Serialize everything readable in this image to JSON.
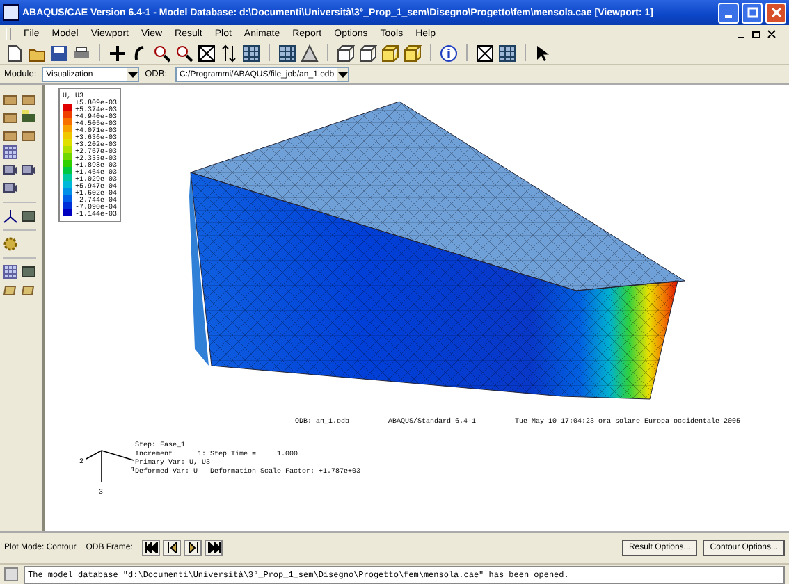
{
  "window": {
    "title": "ABAQUS/CAE Version 6.4-1 - Model Database: d:\\Documenti\\Università\\3°_Prop_1_sem\\Disegno\\Progetto\\fem\\mensola.cae [Viewport: 1]"
  },
  "menu": [
    "File",
    "Model",
    "Viewport",
    "View",
    "Result",
    "Plot",
    "Animate",
    "Report",
    "Options",
    "Tools",
    "Help"
  ],
  "context_bar": {
    "module_label": "Module:",
    "module": "Visualization",
    "odb_label": "ODB:",
    "odb": "C:/Programmi/ABAQUS/file_job/an_1.odb"
  },
  "legend": {
    "title": "U, U3",
    "values": [
      "+5.809e-03",
      "+5.374e-03",
      "+4.940e-03",
      "+4.505e-03",
      "+4.071e-03",
      "+3.636e-03",
      "+3.202e-03",
      "+2.767e-03",
      "+2.333e-03",
      "+1.898e-03",
      "+1.464e-03",
      "+1.029e-03",
      "+5.947e-04",
      "+1.602e-04",
      "-2.744e-04",
      "-7.090e-04",
      "-1.144e-03"
    ]
  },
  "viewport_info": {
    "odb": "ODB: an_1.odb",
    "solver": "ABAQUS/Standard 6.4-1",
    "date": "Tue May 10 17:04:23 ora solare Europa occidentale 2005"
  },
  "step_info": [
    "Step: Fase_1",
    "Increment      1: Step Time =     1.000",
    "Primary Var: U, U3",
    "Deformed Var: U   Deformation Scale Factor: +1.787e+03"
  ],
  "triad": [
    "1",
    "2",
    "3"
  ],
  "bottom_bar": {
    "plot_mode": "Plot Mode: Contour",
    "odb_frame": "ODB Frame:",
    "buttons": [
      "Result Options...",
      "Contour Options..."
    ]
  },
  "message": "The model database \"d:\\Documenti\\Università\\3°_Prop_1_sem\\Disegno\\Progetto\\fem\\mensola.cae\" has been opened."
}
